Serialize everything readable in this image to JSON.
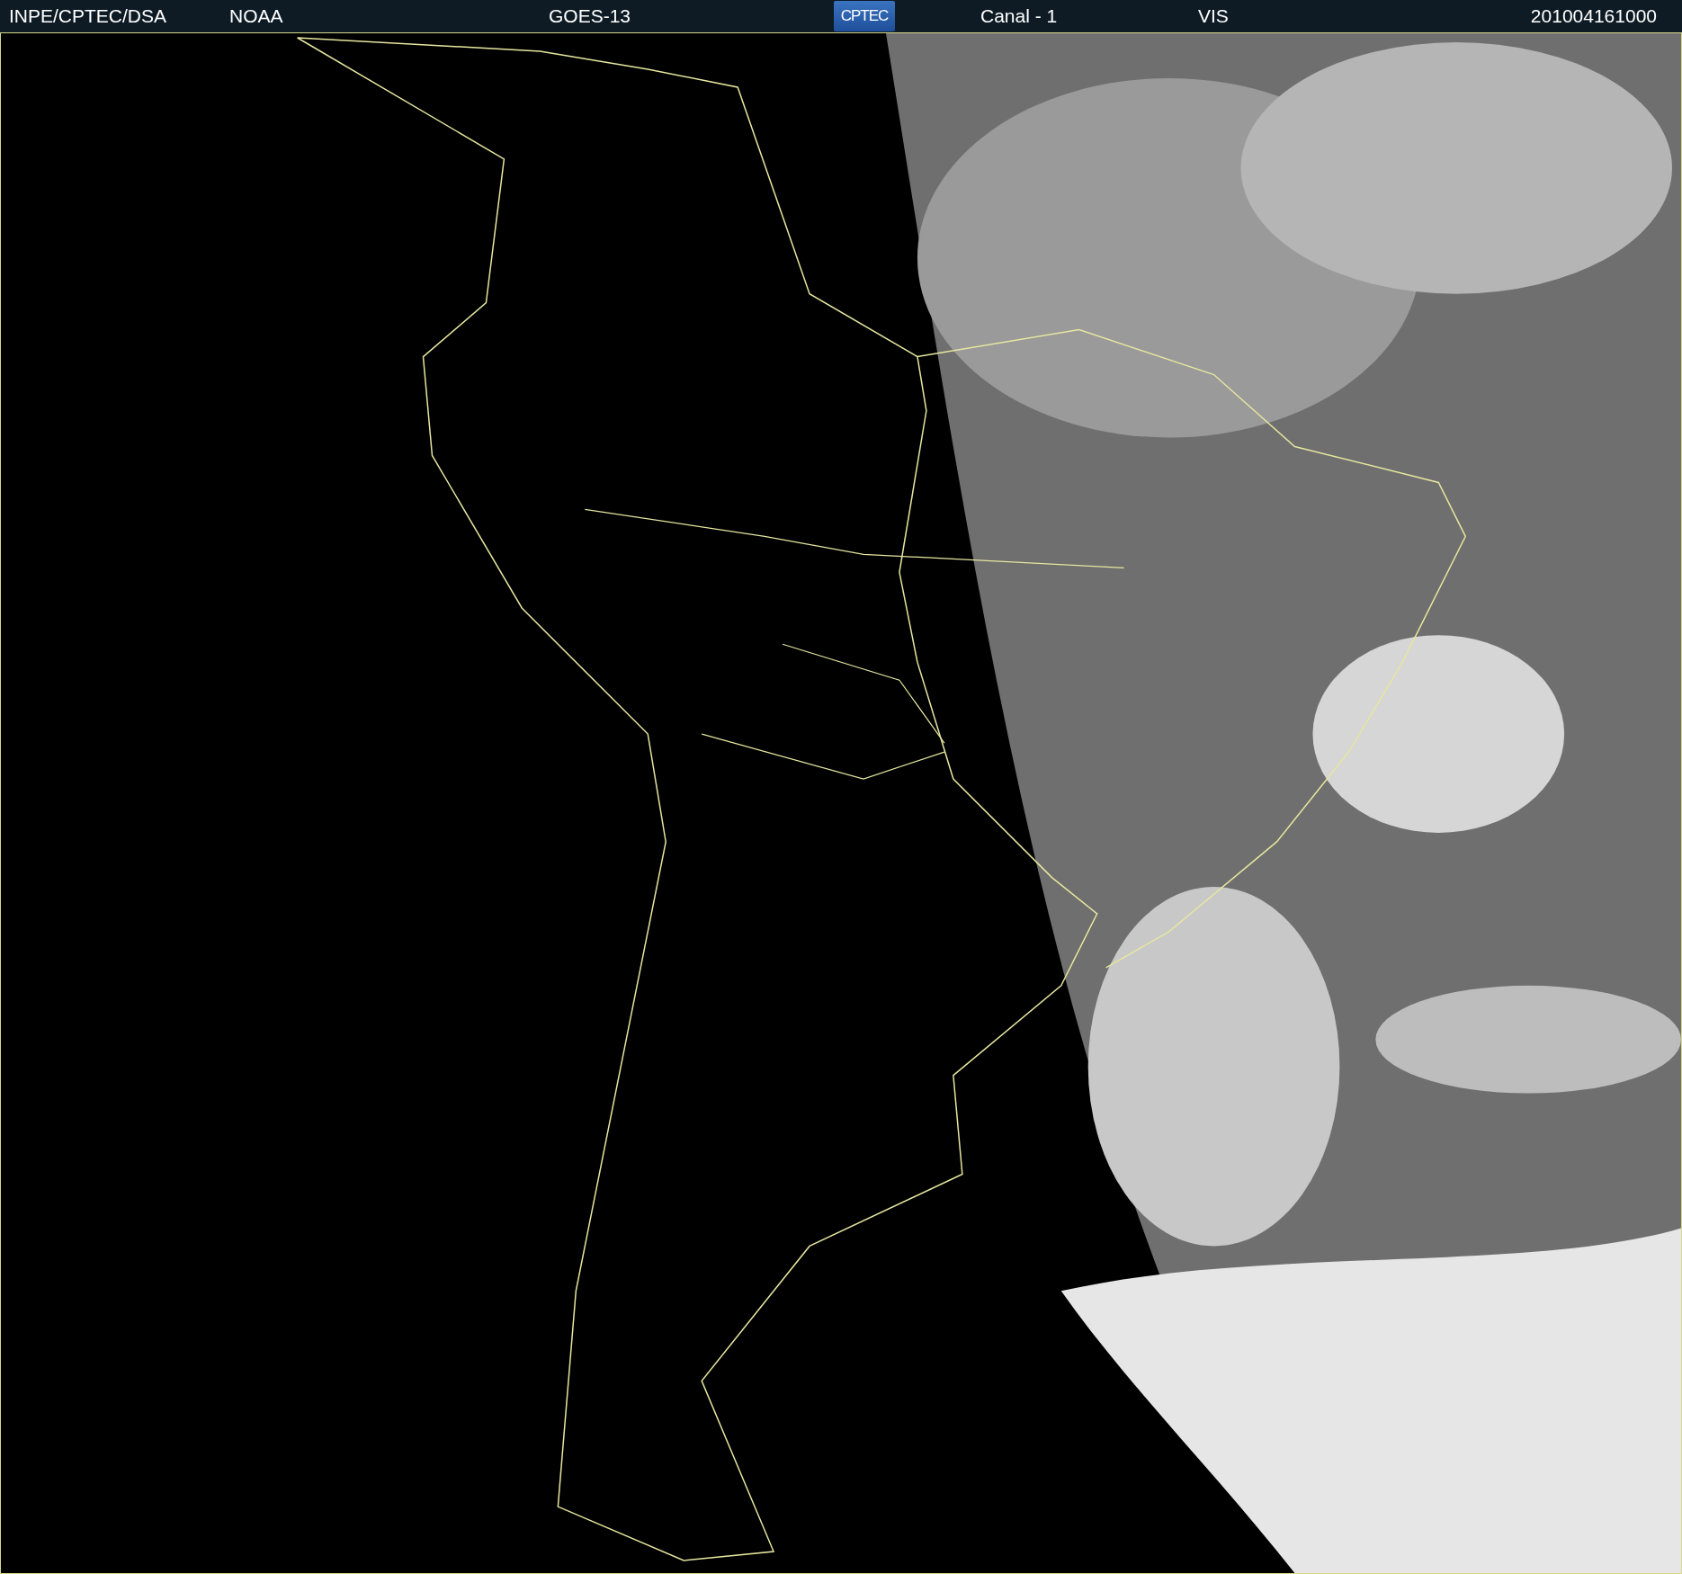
{
  "header": {
    "source": "INPE/CPTEC/DSA",
    "agency": "NOAA",
    "satellite": "GOES-13",
    "logo": "CPTEC",
    "channel": "Canal - 1",
    "band": "VIS",
    "timestamp": "201004161000"
  }
}
